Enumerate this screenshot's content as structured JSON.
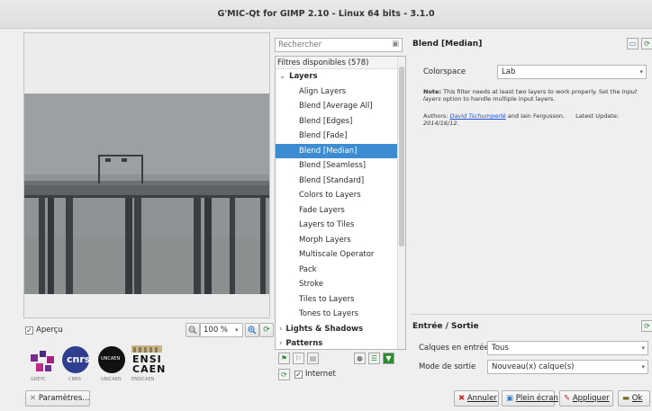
{
  "window": {
    "title": "G'MIC-Qt for GIMP 2.10 - Linux 64 bits - 3.1.0"
  },
  "preview": {
    "apercu_label": "Aperçu",
    "apercu_checked": true,
    "zoom_value": "100 %"
  },
  "logos": {
    "labels": [
      "GREYC",
      "CNRS",
      "UNICAEN",
      "ENSICAEN"
    ],
    "ensi_text": "ENSI",
    "caen_text": "CAEN",
    "unicaen_text": "UNCAEN",
    "cnrs_text": "cnrs"
  },
  "parametres_button": "Paramètres...",
  "search": {
    "placeholder": "Rechercher"
  },
  "filter_tree": {
    "header": "Filtres disponibles (578)",
    "category": "Layers",
    "items": [
      "Align Layers",
      "Blend [Average All]",
      "Blend [Edges]",
      "Blend [Fade]",
      "Blend [Median]",
      "Blend [Seamless]",
      "Blend [Standard]",
      "Colors to Layers",
      "Fade Layers",
      "Layers to Tiles",
      "Morph Layers",
      "Multiscale Operator",
      "Pack",
      "Stroke",
      "Tiles to Layers",
      "Tones to Layers"
    ],
    "selected": "Blend [Median]",
    "next_categories": [
      "Lights & Shadows",
      "Patterns"
    ]
  },
  "internet": {
    "label": "Internet",
    "checked": true
  },
  "filter": {
    "title": "Blend [Median]",
    "colorspace_label": "Colorspace",
    "colorspace_value": "Lab",
    "note_bold": "Note:",
    "note_text_1": " This filter needs at least two layers to work properly. Set the ",
    "note_italic": "Input layers",
    "note_text_2": " option to handle multiple input layers.",
    "authors_prefix": "Authors: ",
    "author_1": "David Tschumperlé",
    "authors_mid": " and Iain Fergusson.",
    "latest_update_label": "Latest Update:",
    "latest_update_date": "2014/16/12."
  },
  "io": {
    "title": "Entrée / Sortie",
    "inputs_label": "Calques en entrée",
    "inputs_value": "Tous",
    "output_label": "Mode de sortie",
    "output_value": "Nouveau(x) calque(s)"
  },
  "actions": {
    "cancel": "Annuler",
    "fullscreen": "Plein écran",
    "apply": "Appliquer",
    "ok": "Ok"
  }
}
